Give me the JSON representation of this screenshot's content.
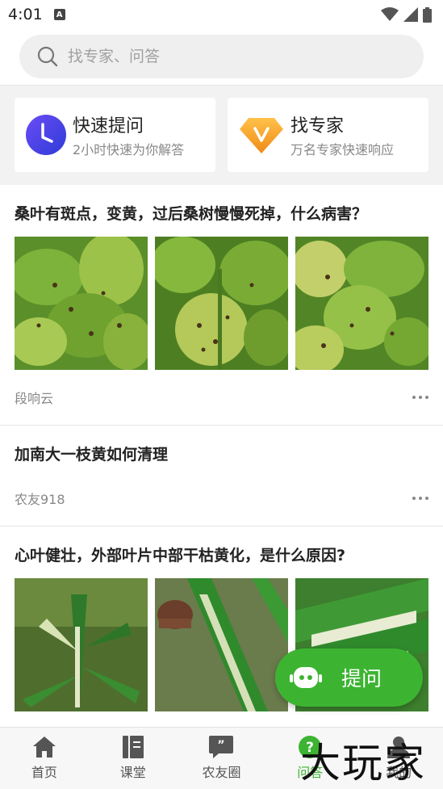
{
  "status": {
    "time": "4:01",
    "notif_letter": "A"
  },
  "search": {
    "placeholder": "找专家、问答"
  },
  "quick": [
    {
      "title": "快速提问",
      "subtitle": "2小时快速为你解答",
      "icon": "clock-icon",
      "color": "#4b3fe0"
    },
    {
      "title": "找专家",
      "subtitle": "万名专家快速响应",
      "icon": "v-diamond-icon",
      "color": "#f5a623"
    }
  ],
  "posts": [
    {
      "title": "桑叶有斑点，变黄，过后桑树慢慢死掉，什么病害？",
      "author": "段响云",
      "images": [
        "mulberry-leaf-photo",
        "mulberry-leaf-photo",
        "mulberry-leaf-photo"
      ]
    },
    {
      "title": "加南大一枝黄如何清理",
      "author": "农友918",
      "images": []
    },
    {
      "title": "心叶健壮，外部叶片中部干枯黄化，是什么原因?",
      "author": "",
      "images": [
        "corn-plant-photo",
        "corn-leaf-photo",
        "corn-leaf-photo"
      ]
    }
  ],
  "fab": {
    "label": "提问",
    "icon": "robot-icon"
  },
  "tabs": [
    {
      "label": "首页",
      "icon": "home-icon"
    },
    {
      "label": "课堂",
      "icon": "book-icon"
    },
    {
      "label": "农友圈",
      "icon": "chat-quote-icon"
    },
    {
      "label": "问答",
      "icon": "question-icon",
      "active": true
    },
    {
      "label": "我的",
      "icon": "user-icon"
    }
  ],
  "watermark": "大玩家",
  "colors": {
    "accent": "#3cb431"
  }
}
